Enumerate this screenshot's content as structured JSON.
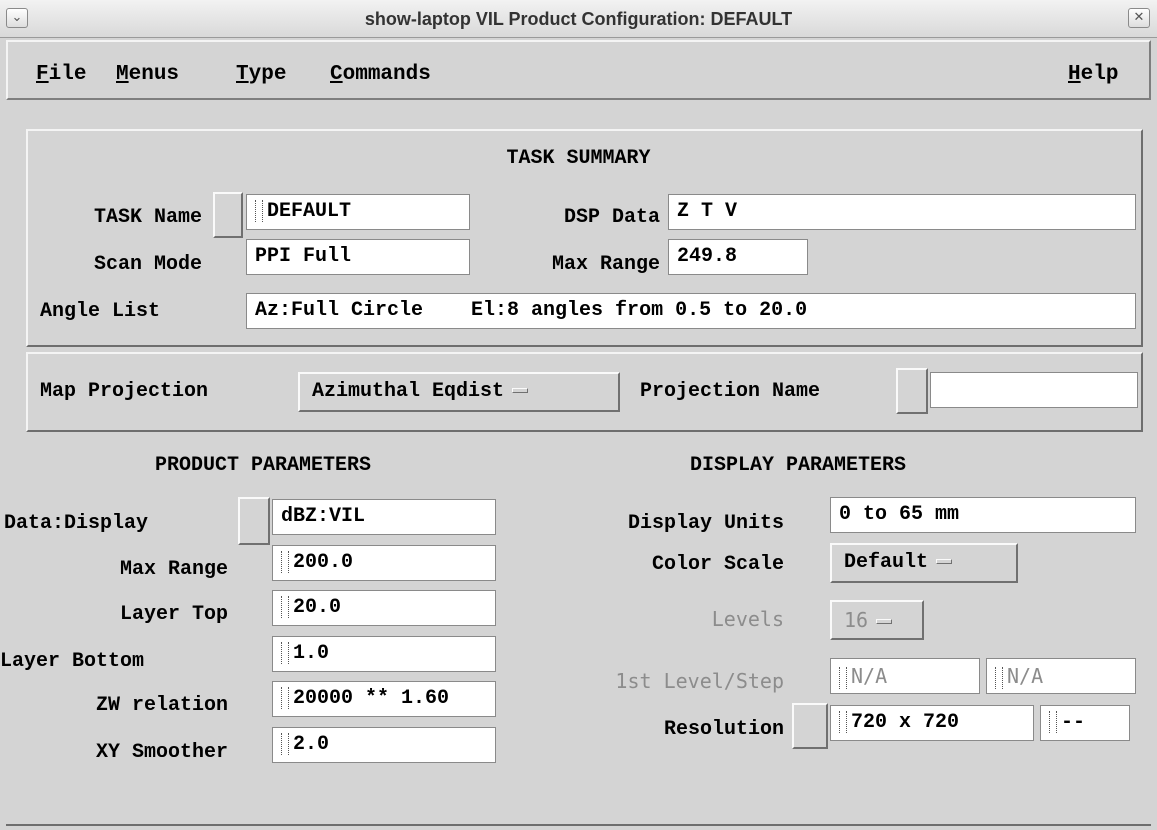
{
  "window": {
    "title": "show-laptop  VIL Product Configuration: DEFAULT",
    "menu_icon": "chevron-down-icon",
    "close_icon": "close-icon"
  },
  "menubar": {
    "file": {
      "mnemonic": "F",
      "rest": "ile"
    },
    "menus": {
      "mnemonic": "M",
      "rest": "enus"
    },
    "type": {
      "mnemonic": "T",
      "rest": "ype"
    },
    "commands": {
      "mnemonic": "C",
      "rest": "ommands"
    },
    "help": {
      "mnemonic": "H",
      "rest": "elp"
    }
  },
  "task_summary": {
    "heading": "TASK SUMMARY",
    "task_name_label": "TASK Name",
    "task_name_value": "DEFAULT",
    "dsp_data_label": "DSP Data",
    "dsp_data_value": "Z T V",
    "scan_mode_label": "Scan Mode",
    "scan_mode_value": "PPI Full",
    "max_range_label": "Max Range",
    "max_range_value": "249.8",
    "angle_list_label": "Angle List",
    "angle_list_value": "Az:Full Circle    El:8 angles from 0.5 to 20.0"
  },
  "map": {
    "projection_label": "Map Projection",
    "projection_value": "Azimuthal Eqdist",
    "projection_name_label": "Projection Name",
    "projection_name_value": ""
  },
  "product_parameters": {
    "heading": "PRODUCT PARAMETERS",
    "data_display_label": "Data:Display",
    "data_display_value": "dBZ:VIL",
    "max_range_label": "Max Range",
    "max_range_value": "200.0",
    "layer_top_label": "Layer Top",
    "layer_top_value": "20.0",
    "layer_bottom_label": "Layer Bottom",
    "layer_bottom_value": "1.0",
    "zw_relation_label": "ZW relation",
    "zw_relation_value": "20000 ** 1.60",
    "xy_smoother_label": "XY Smoother",
    "xy_smoother_value": "2.0"
  },
  "display_parameters": {
    "heading": "DISPLAY PARAMETERS",
    "display_units_label": "Display Units",
    "display_units_value": "0 to 65 mm",
    "color_scale_label": "Color Scale",
    "color_scale_value": "Default",
    "levels_label": "Levels",
    "levels_value": "16",
    "first_level_label": "1st Level/Step",
    "first_level_value": "N/A",
    "step_value": "N/A",
    "resolution_label": "Resolution",
    "resolution_value": "720 x 720",
    "resolution_extra": "--"
  }
}
